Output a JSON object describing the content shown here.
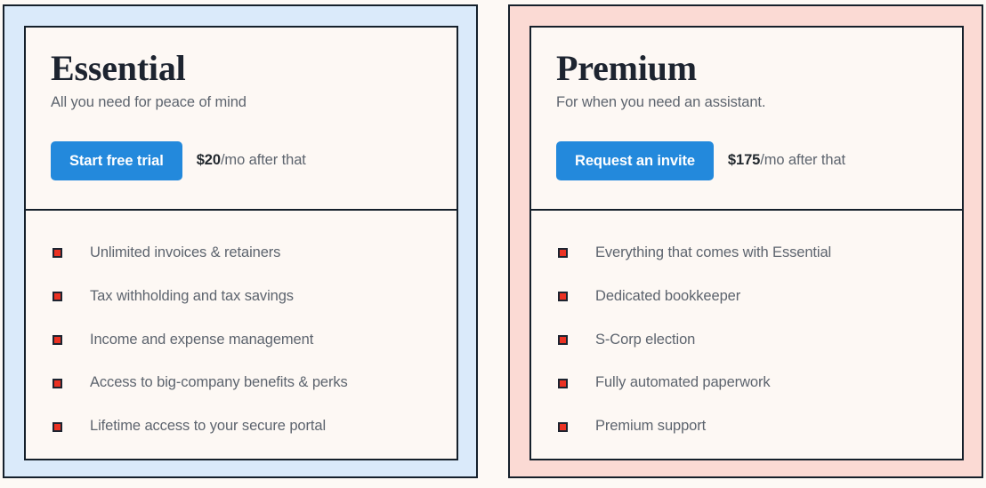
{
  "theme": {
    "page_background": "#fdf9f5",
    "card_background": "#fdf8f4",
    "border_color": "#15202b",
    "accent_button": "#2389dc",
    "bullet_color": "#eb3223",
    "title_color": "#1d2430",
    "body_text_color": "#5d646e"
  },
  "plans": [
    {
      "frame_color": "#daeafa",
      "name": "Essential",
      "tagline": "All you need for peace of mind",
      "cta_label": "Start free trial",
      "price_amount": "$20",
      "price_suffix": "/mo after that",
      "features": [
        "Unlimited invoices & retainers",
        "Tax withholding and tax savings",
        "Income and expense management",
        "Access to big-company benefits & perks",
        "Lifetime access to your secure portal"
      ]
    },
    {
      "frame_color": "#fbdad4",
      "name": "Premium",
      "tagline": "For when you need an assistant.",
      "cta_label": "Request an invite",
      "price_amount": "$175",
      "price_suffix": "/mo after that",
      "features": [
        "Everything that comes with Essential",
        "Dedicated bookkeeper",
        "S-Corp election",
        "Fully automated paperwork",
        "Premium support"
      ]
    }
  ]
}
